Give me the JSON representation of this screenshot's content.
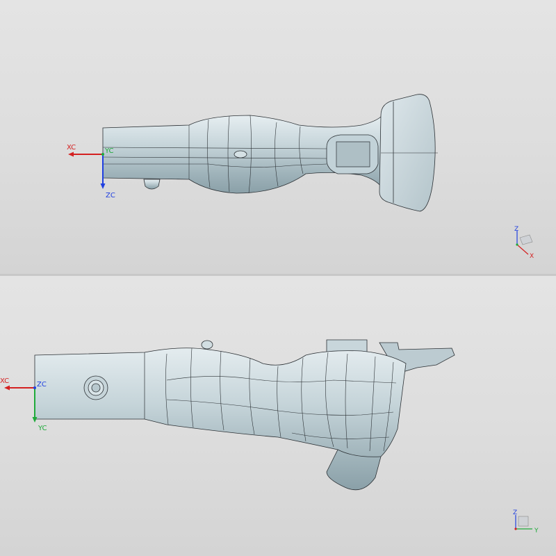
{
  "views": {
    "top": {
      "csys": {
        "horizontal_axis": "XC",
        "origin_axis": "YC",
        "vertical_axis": "ZC"
      },
      "triad": {
        "up": "Z",
        "side": "X"
      }
    },
    "bottom": {
      "csys": {
        "horizontal_axis": "XC",
        "origin_axis": "ZC",
        "vertical_axis": "YC"
      },
      "triad": {
        "up": "Z",
        "side": "Y"
      }
    }
  },
  "colors": {
    "x_axis": "#d42020",
    "y_axis": "#1faa3a",
    "z_axis": "#1f3fe0",
    "model_surface": "#b4c6cc",
    "model_edge": "#2a2f33"
  },
  "icons": [
    "csys-triad-icon",
    "view-triad-icon"
  ]
}
